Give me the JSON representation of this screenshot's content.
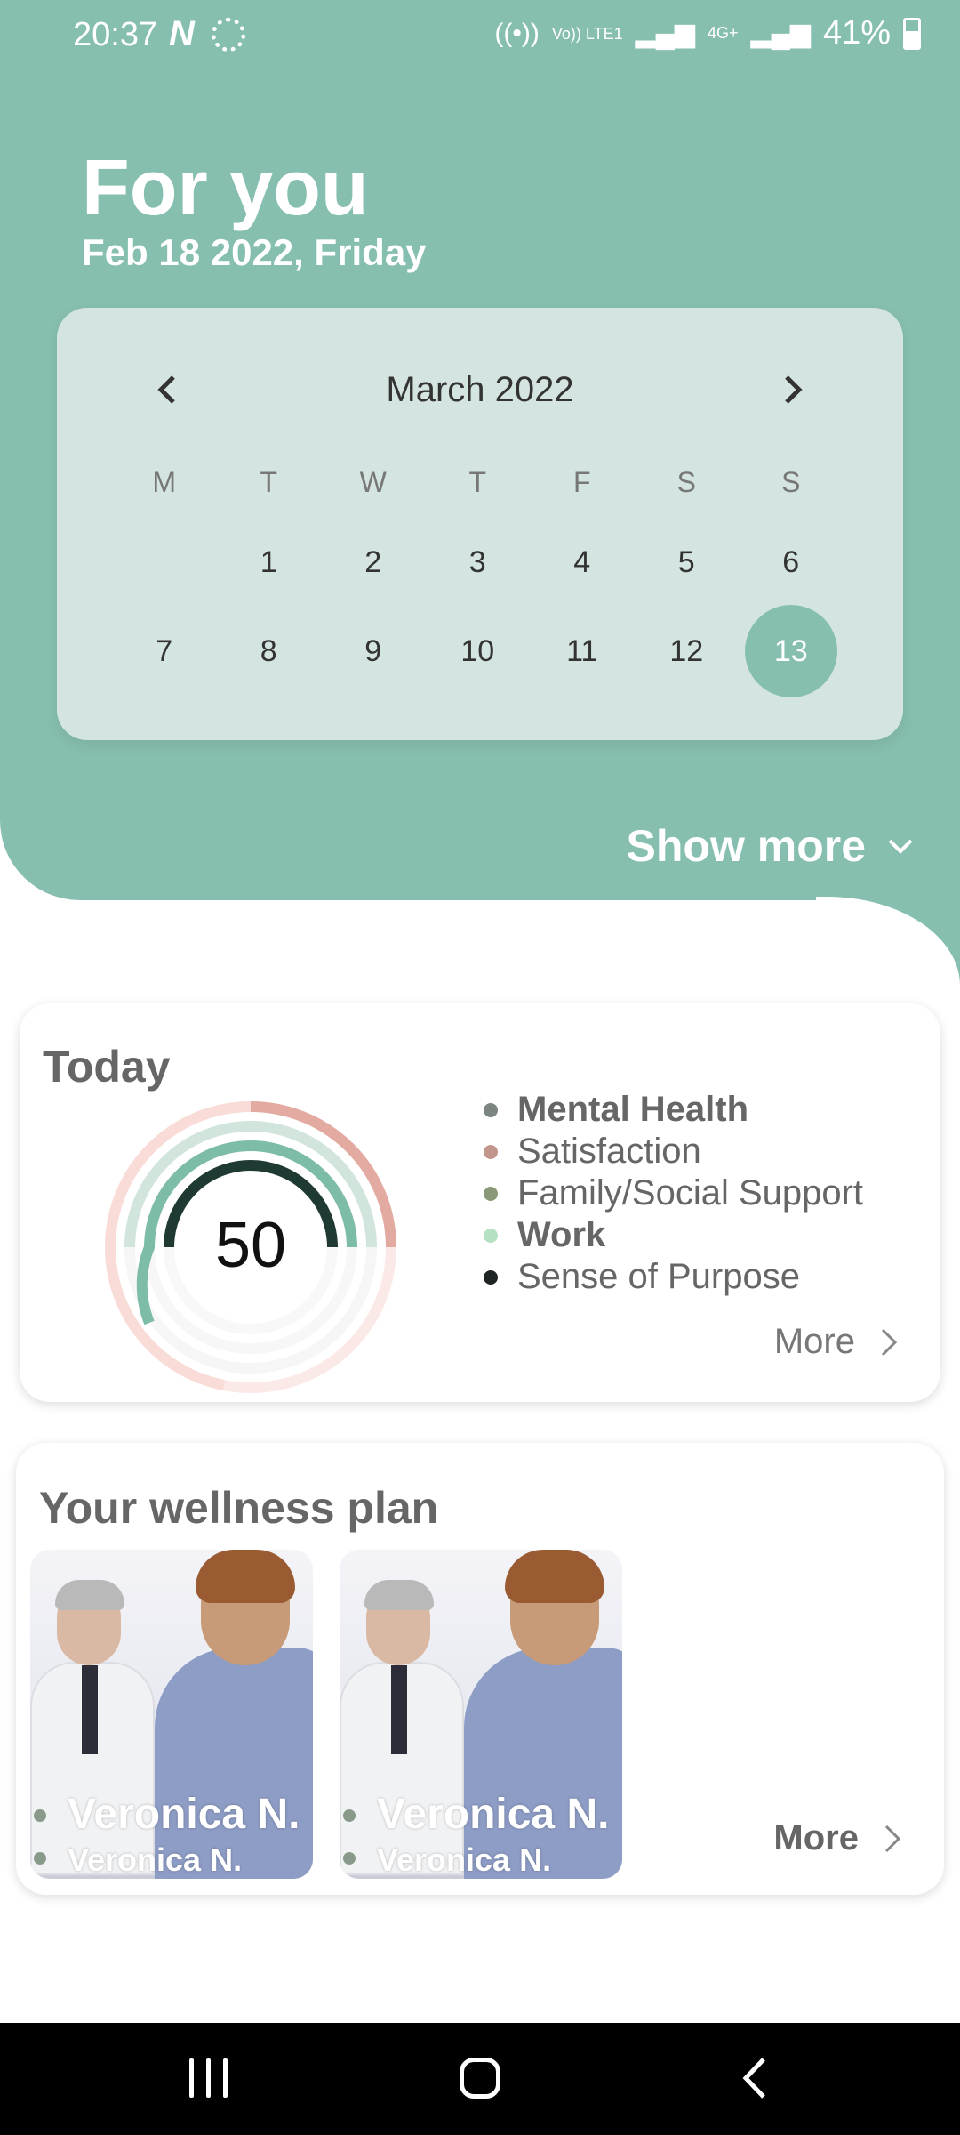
{
  "status_bar": {
    "time": "20:37",
    "notif_icon": "N",
    "signal_text": "Vo)) LTE1",
    "network_text": "4G+",
    "battery": "41%"
  },
  "header": {
    "title": "For you",
    "date": "Feb 18 2022, Friday",
    "show_more": "Show more"
  },
  "calendar": {
    "month": "March 2022",
    "weekdays": [
      "M",
      "T",
      "W",
      "T",
      "F",
      "S",
      "S"
    ],
    "weeks": [
      [
        "",
        "1",
        "2",
        "3",
        "4",
        "5",
        "6"
      ],
      [
        "7",
        "8",
        "9",
        "10",
        "11",
        "12",
        "13"
      ]
    ],
    "selected_day": "13",
    "accent_color": "#86bfaf"
  },
  "today_card": {
    "title": "Today",
    "score": "50",
    "legend": [
      {
        "label": "Mental Health",
        "color": "#7c8580",
        "bold": true
      },
      {
        "label": "Satisfaction",
        "color": "#c2958a",
        "bold": false
      },
      {
        "label": "Family/Social Support",
        "color": "#8a9a78",
        "bold": false
      },
      {
        "label": "Work",
        "color": "#b5e0c1",
        "bold": true
      },
      {
        "label": "Sense of Purpose",
        "color": "#1e2524",
        "bold": false
      }
    ],
    "more": "More"
  },
  "wellness_card": {
    "title": "Your wellness plan",
    "tiles": [
      {
        "name": "Veronica N.",
        "subname": "Veronica N."
      },
      {
        "name": "Veronica N.",
        "subname": "Veronica N."
      }
    ],
    "more": "More"
  }
}
